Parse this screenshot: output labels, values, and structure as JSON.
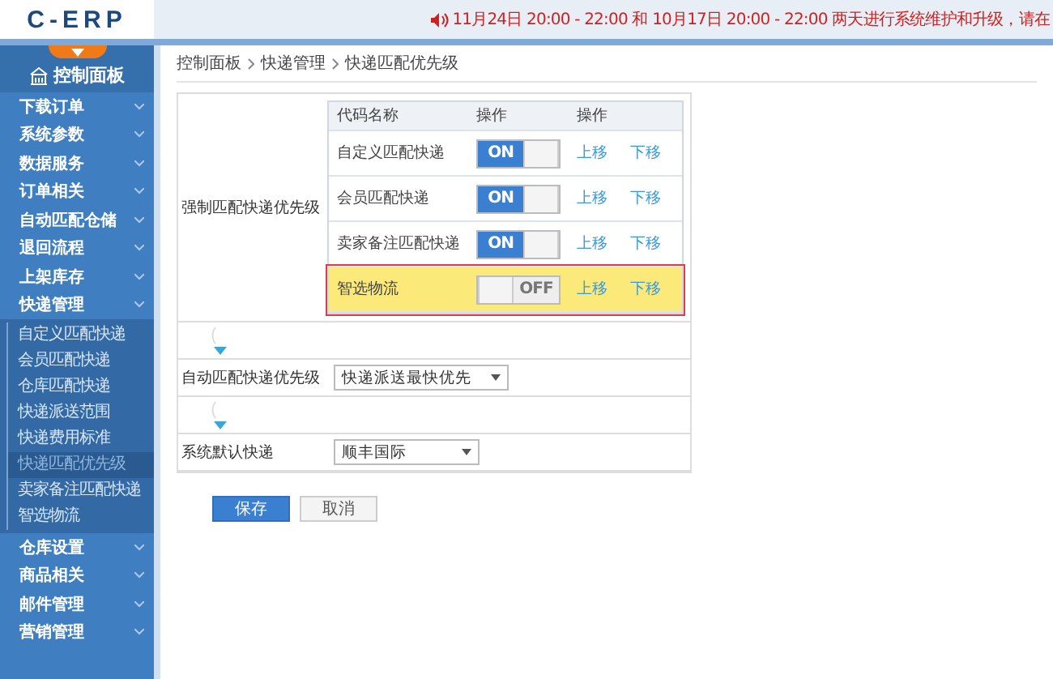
{
  "header": {
    "logo": "C-ERP",
    "notice": "11月24日 20:00 - 22:00 和 10月17日 20:00 - 22:00 两天进行系统维护和升级，请在"
  },
  "sidebar": {
    "title": "控制面板",
    "items": [
      {
        "label": "下载订单"
      },
      {
        "label": "系统参数"
      },
      {
        "label": "数据服务"
      },
      {
        "label": "订单相关"
      },
      {
        "label": "自动匹配仓储"
      },
      {
        "label": "退回流程"
      },
      {
        "label": "上架库存"
      },
      {
        "label": "快递管理",
        "children": [
          {
            "label": "自定义匹配快递",
            "selected": false
          },
          {
            "label": "会员匹配快递",
            "selected": false
          },
          {
            "label": "仓库匹配快递",
            "selected": false
          },
          {
            "label": "快递派送范围",
            "selected": false
          },
          {
            "label": "快递费用标准",
            "selected": false
          },
          {
            "label": "快递匹配优先级",
            "selected": true
          },
          {
            "label": "卖家备注匹配快递",
            "selected": false
          },
          {
            "label": "智选物流",
            "selected": false
          }
        ]
      },
      {
        "label": "仓库设置"
      },
      {
        "label": "商品相关"
      },
      {
        "label": "邮件管理"
      },
      {
        "label": "营销管理"
      }
    ]
  },
  "breadcrumb": [
    "控制面板",
    "快递管理",
    "快递匹配优先级"
  ],
  "form": {
    "forced": {
      "label": "强制匹配快递优先级",
      "columns": [
        "代码名称",
        "操作",
        "操作"
      ],
      "rows": [
        {
          "name": "自定义匹配快递",
          "on": true,
          "switch_label": "ON",
          "up": "上移",
          "down": "下移",
          "highlighted": false
        },
        {
          "name": "会员匹配快递",
          "on": true,
          "switch_label": "ON",
          "up": "上移",
          "down": "下移",
          "highlighted": false
        },
        {
          "name": "卖家备注匹配快递",
          "on": true,
          "switch_label": "ON",
          "up": "上移",
          "down": "下移",
          "highlighted": false
        },
        {
          "name": "智选物流",
          "on": false,
          "switch_label": "OFF",
          "up": "上移",
          "down": "下移",
          "highlighted": true
        }
      ]
    },
    "auto": {
      "label": "自动匹配快递优先级",
      "value": "快递派送最快优先"
    },
    "default": {
      "label": "系统默认快递",
      "value": "顺丰国际"
    }
  },
  "buttons": [
    {
      "label": "保存",
      "kind": "primary"
    },
    {
      "label": "取消",
      "kind": "secondary"
    }
  ]
}
